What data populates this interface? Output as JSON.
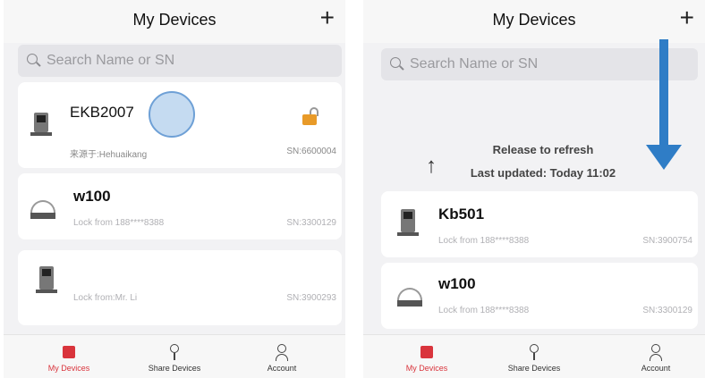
{
  "left": {
    "header": {
      "title": "My Devices",
      "add": "+"
    },
    "search": {
      "placeholder": "Search Name or SN"
    },
    "devices": [
      {
        "name": "EKB2007",
        "from": "来源于:Hehuaikang",
        "sn": "SN:6600004",
        "icon": "door-lock-icon"
      },
      {
        "name": "w100",
        "from": "Lock from 188****8388",
        "sn": "SN:3300129",
        "icon": "round-lock-icon"
      },
      {
        "name": "",
        "from": "Lock from:Mr. Li",
        "sn": "SN:3900293",
        "icon": "door-lock-icon"
      }
    ]
  },
  "right": {
    "header": {
      "title": "My Devices",
      "add": "+"
    },
    "search": {
      "placeholder": "Search Name or SN"
    },
    "refresh": {
      "arrow": "↑",
      "line1": "Release to refresh",
      "line2": "Last updated: Today 11:02"
    },
    "devices": [
      {
        "name": "Kb501",
        "from": "Lock from 188****8388",
        "sn": "SN:3900754",
        "icon": "door-lock-icon"
      },
      {
        "name": "w100",
        "from": "Lock from 188****8388",
        "sn": "SN:3300129",
        "icon": "round-lock-icon"
      }
    ]
  },
  "tabs": [
    {
      "label": "My Devices",
      "icon": "devices-bag-icon",
      "active": true
    },
    {
      "label": "Share Devices",
      "icon": "key-pin-icon",
      "active": false
    },
    {
      "label": "Account",
      "icon": "person-icon",
      "active": false
    }
  ],
  "colors": {
    "accent": "#d9343c",
    "arrow": "#2f7dc6",
    "padlock": "#e89a28"
  }
}
